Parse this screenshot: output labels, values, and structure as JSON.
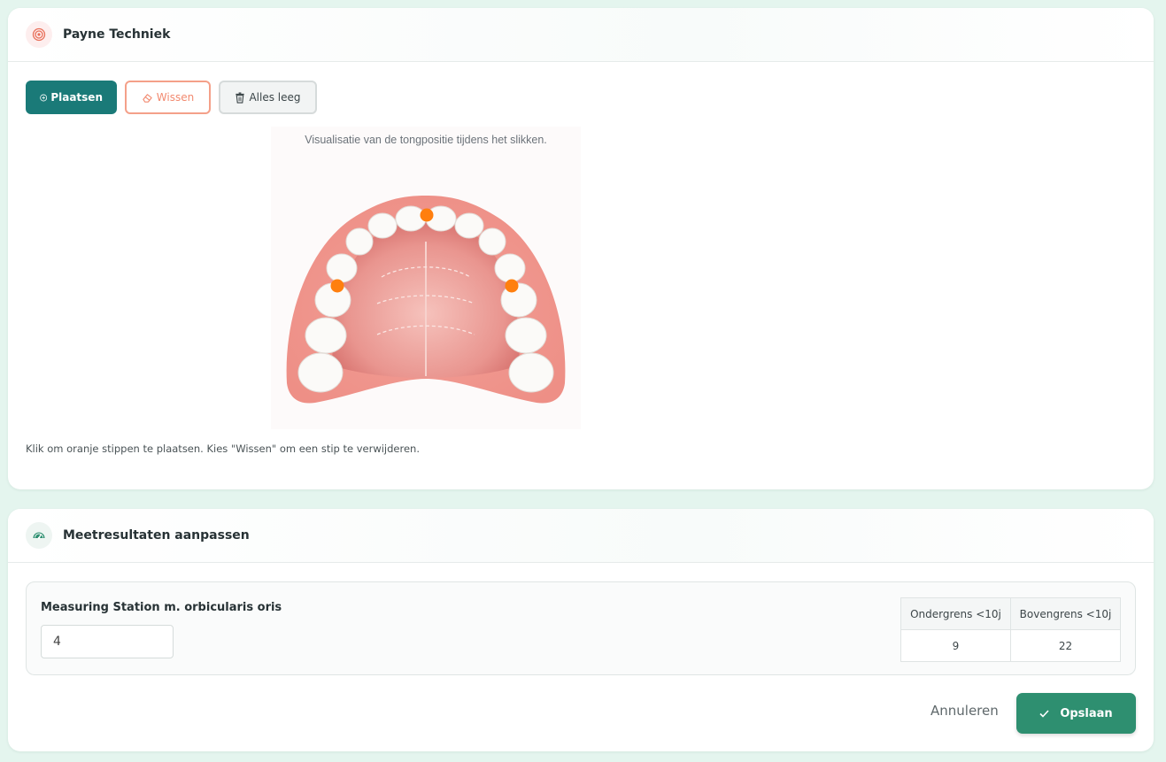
{
  "payne": {
    "title": "Payne Techniek",
    "icon": "target-icon",
    "toolbar": {
      "place_label": "Plaatsen",
      "erase_label": "Wissen",
      "clear_label": "Alles leeg"
    },
    "figure_caption": "Visualisatie van de tongpositie tijdens het slikken.",
    "hint": "Klik om oranje stippen te plaatsen. Kies \"Wissen\" om een stip te verwijderen.",
    "dot_color": "#ff7f0e",
    "accent": "#1a7a78"
  },
  "measurement": {
    "title": "Meetresultaten aanpassen",
    "icon": "gauge-icon",
    "label": "Measuring Station m. orbicularis oris",
    "value": "4",
    "table": {
      "headers": [
        "Ondergrens <10j",
        "Bovengrens <10j"
      ],
      "values": [
        "9",
        "22"
      ]
    },
    "cancel_label": "Annuleren",
    "save_label": "Opslaan",
    "save_color": "#2e8f70"
  }
}
